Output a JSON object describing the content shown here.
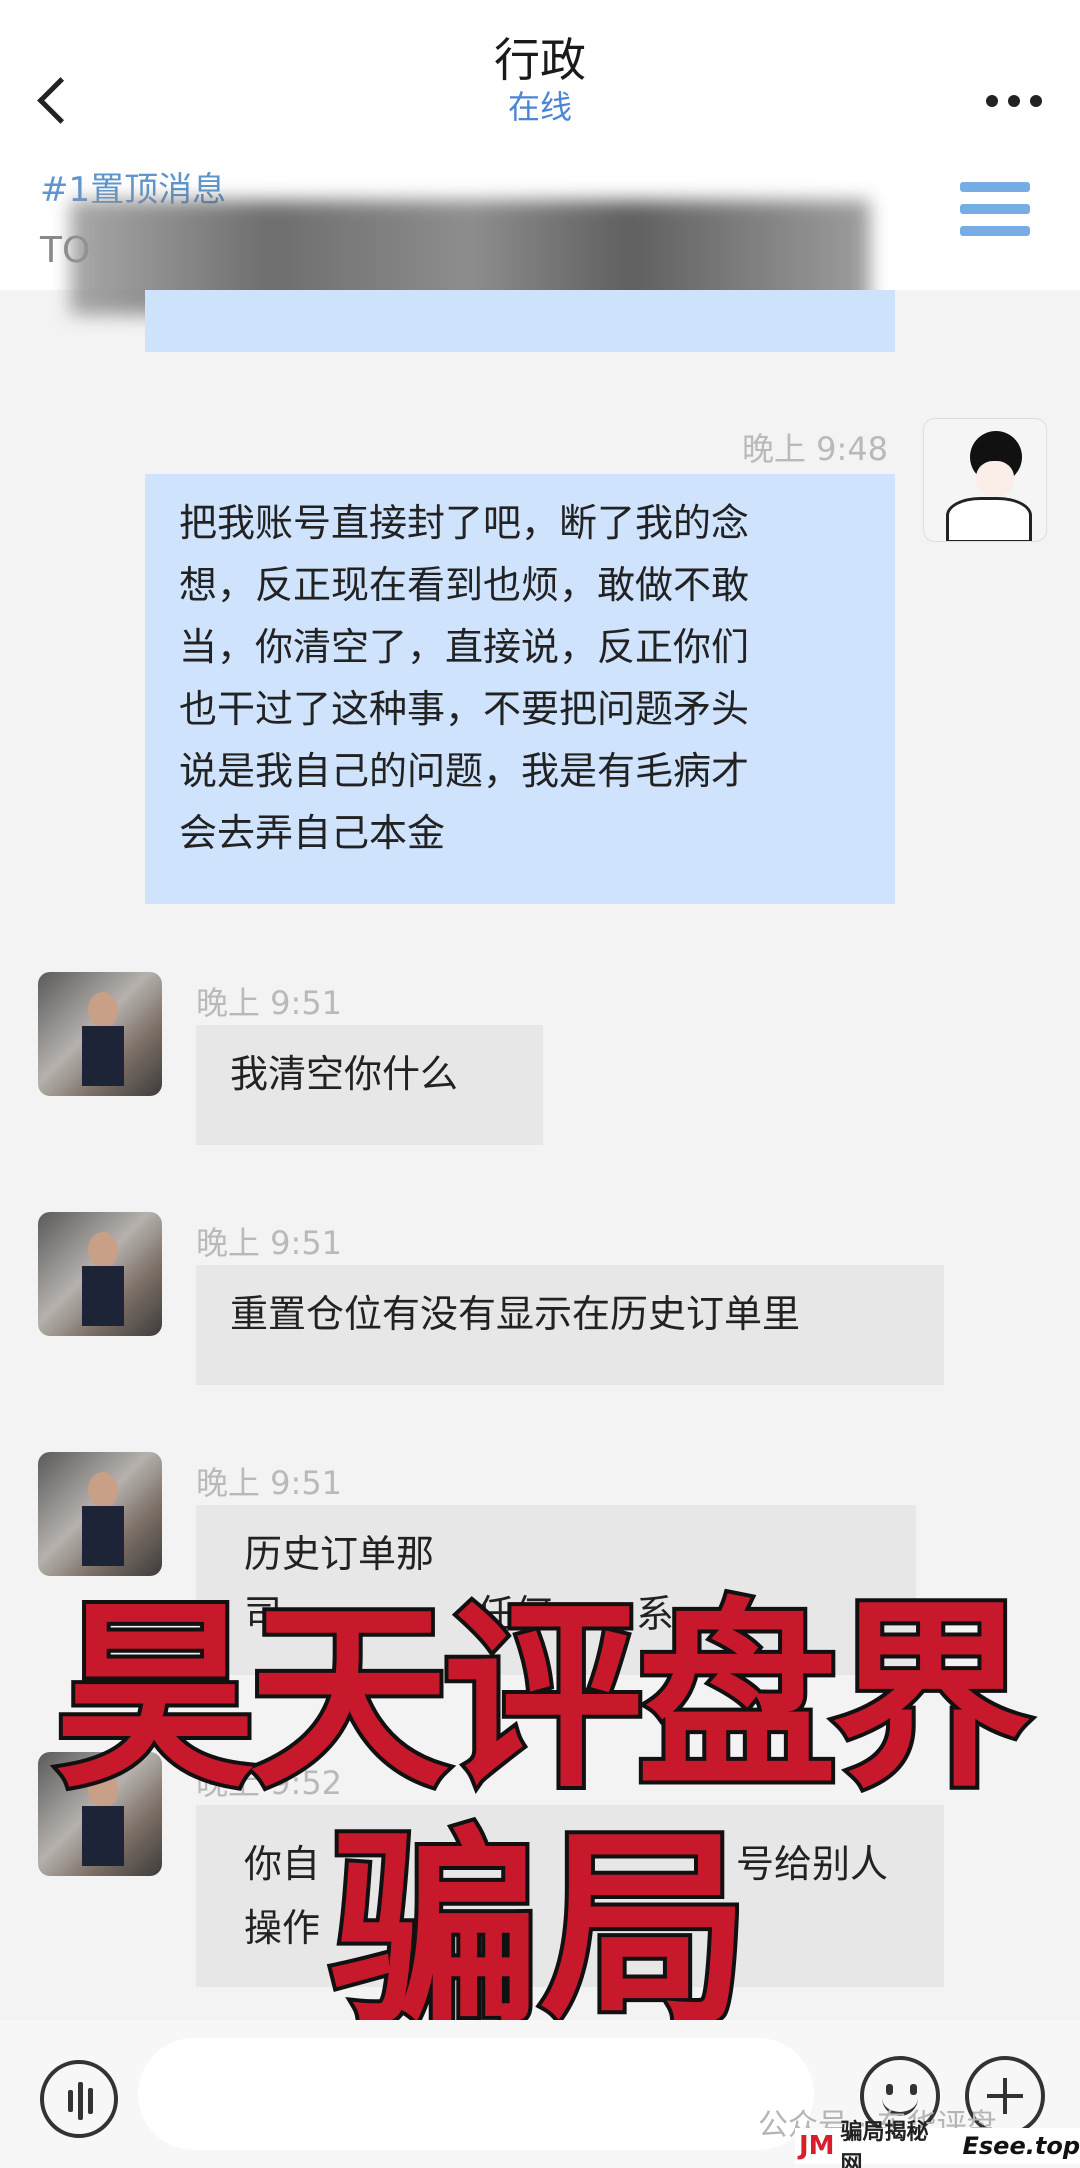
{
  "header": {
    "title": "行政",
    "status": "在线",
    "back_icon": "chevron-left-icon",
    "more_icon": "more-dots-icon"
  },
  "pinned": {
    "label": "#1置顶消息",
    "text": "TO"
  },
  "messages": [
    {
      "side": "right",
      "time": "晚上 9:48",
      "lines": [
        "把我账号直接封了吧，断了我的念",
        "想，反正现在看到也烦，敢做不敢",
        "当，你清空了，直接说，反正你们",
        "也干过了这种事，不要把问题矛头",
        "说是我自己的问题，我是有毛病才",
        "会去弄自己本金"
      ]
    },
    {
      "side": "left",
      "time": "晚上 9:51",
      "lines": [
        "我清空你什么"
      ]
    },
    {
      "side": "left",
      "time": "晚上 9:51",
      "lines": [
        "重置仓位有没有显示在历史订单里"
      ]
    },
    {
      "side": "left",
      "time": "晚上 9:51",
      "lines": [
        "历史订单那",
        "司",
        "任何",
        "系"
      ]
    },
    {
      "side": "left",
      "time": "晚上 9:52",
      "lines": [
        "你自",
        "号给别人",
        "操作"
      ]
    }
  ],
  "overlay": {
    "line1": "昊天评盘界",
    "line2": "骗局",
    "color": "#c8192c"
  },
  "watermark": {
    "wechat": "公众号 · 东华评盘",
    "logo": "JM",
    "name": "骗局揭秘网",
    "site": "Esee.top"
  },
  "colors": {
    "accent": "#4a86d4",
    "sent_bubble": "#cfe3fc",
    "received_bubble": "#e7e7e7"
  }
}
